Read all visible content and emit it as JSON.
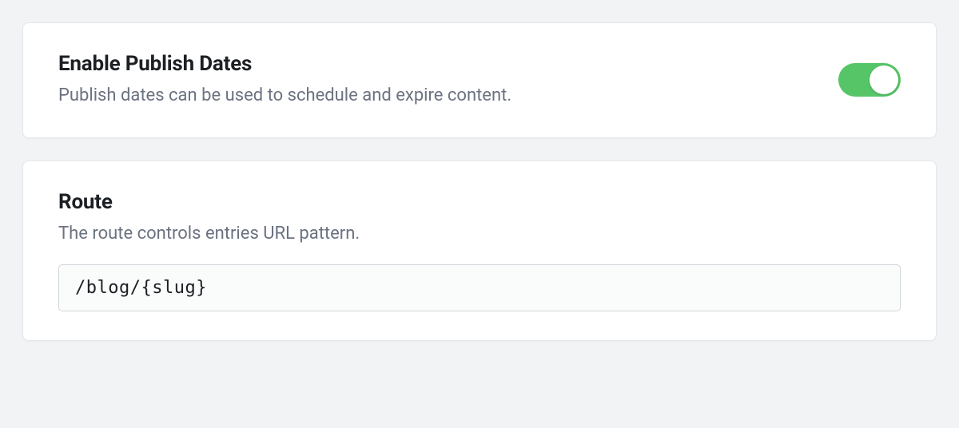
{
  "publishDates": {
    "title": "Enable Publish Dates",
    "description": "Publish dates can be used to schedule and expire content.",
    "enabled": true
  },
  "route": {
    "title": "Route",
    "description": "The route controls entries URL pattern.",
    "value": "/blog/{slug}"
  }
}
